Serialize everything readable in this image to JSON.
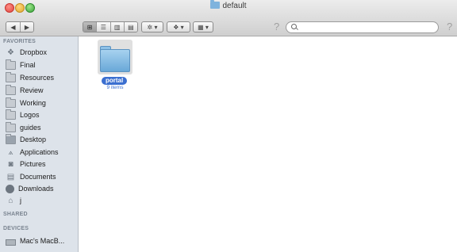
{
  "window": {
    "title": "default"
  },
  "toolbar": {
    "back_label": "◀",
    "forward_label": "▶",
    "view_icons": "⊞",
    "view_list": "☰",
    "view_columns": "▥",
    "view_coverflow": "▤",
    "action_label": "✲ ▾",
    "dropbox_label": "❖ ▾",
    "arrange_label": "▦ ▾",
    "help_icon": "?",
    "search_placeholder": ""
  },
  "sidebar": {
    "favorites_header": "FAVORITES",
    "items": [
      {
        "label": "Dropbox",
        "icon": "dropbox-icon"
      },
      {
        "label": "Final",
        "icon": "folder-icon"
      },
      {
        "label": "Resources",
        "icon": "folder-icon"
      },
      {
        "label": "Review",
        "icon": "folder-icon"
      },
      {
        "label": "Working",
        "icon": "folder-icon"
      },
      {
        "label": "Logos",
        "icon": "folder-icon"
      },
      {
        "label": "guides",
        "icon": "folder-icon"
      },
      {
        "label": "Desktop",
        "icon": "desktop-icon"
      },
      {
        "label": "Applications",
        "icon": "applications-icon"
      },
      {
        "label": "Pictures",
        "icon": "camera-icon"
      },
      {
        "label": "Documents",
        "icon": "documents-icon"
      },
      {
        "label": "Downloads",
        "icon": "download-icon"
      },
      {
        "label": "j",
        "icon": "home-icon"
      }
    ],
    "shared_header": "SHARED",
    "devices_header": "DEVICES",
    "devices": [
      {
        "label": "Mac's MacB...",
        "icon": "laptop-icon"
      }
    ]
  },
  "content": {
    "folder_name": "portal",
    "folder_count": "9 items"
  }
}
